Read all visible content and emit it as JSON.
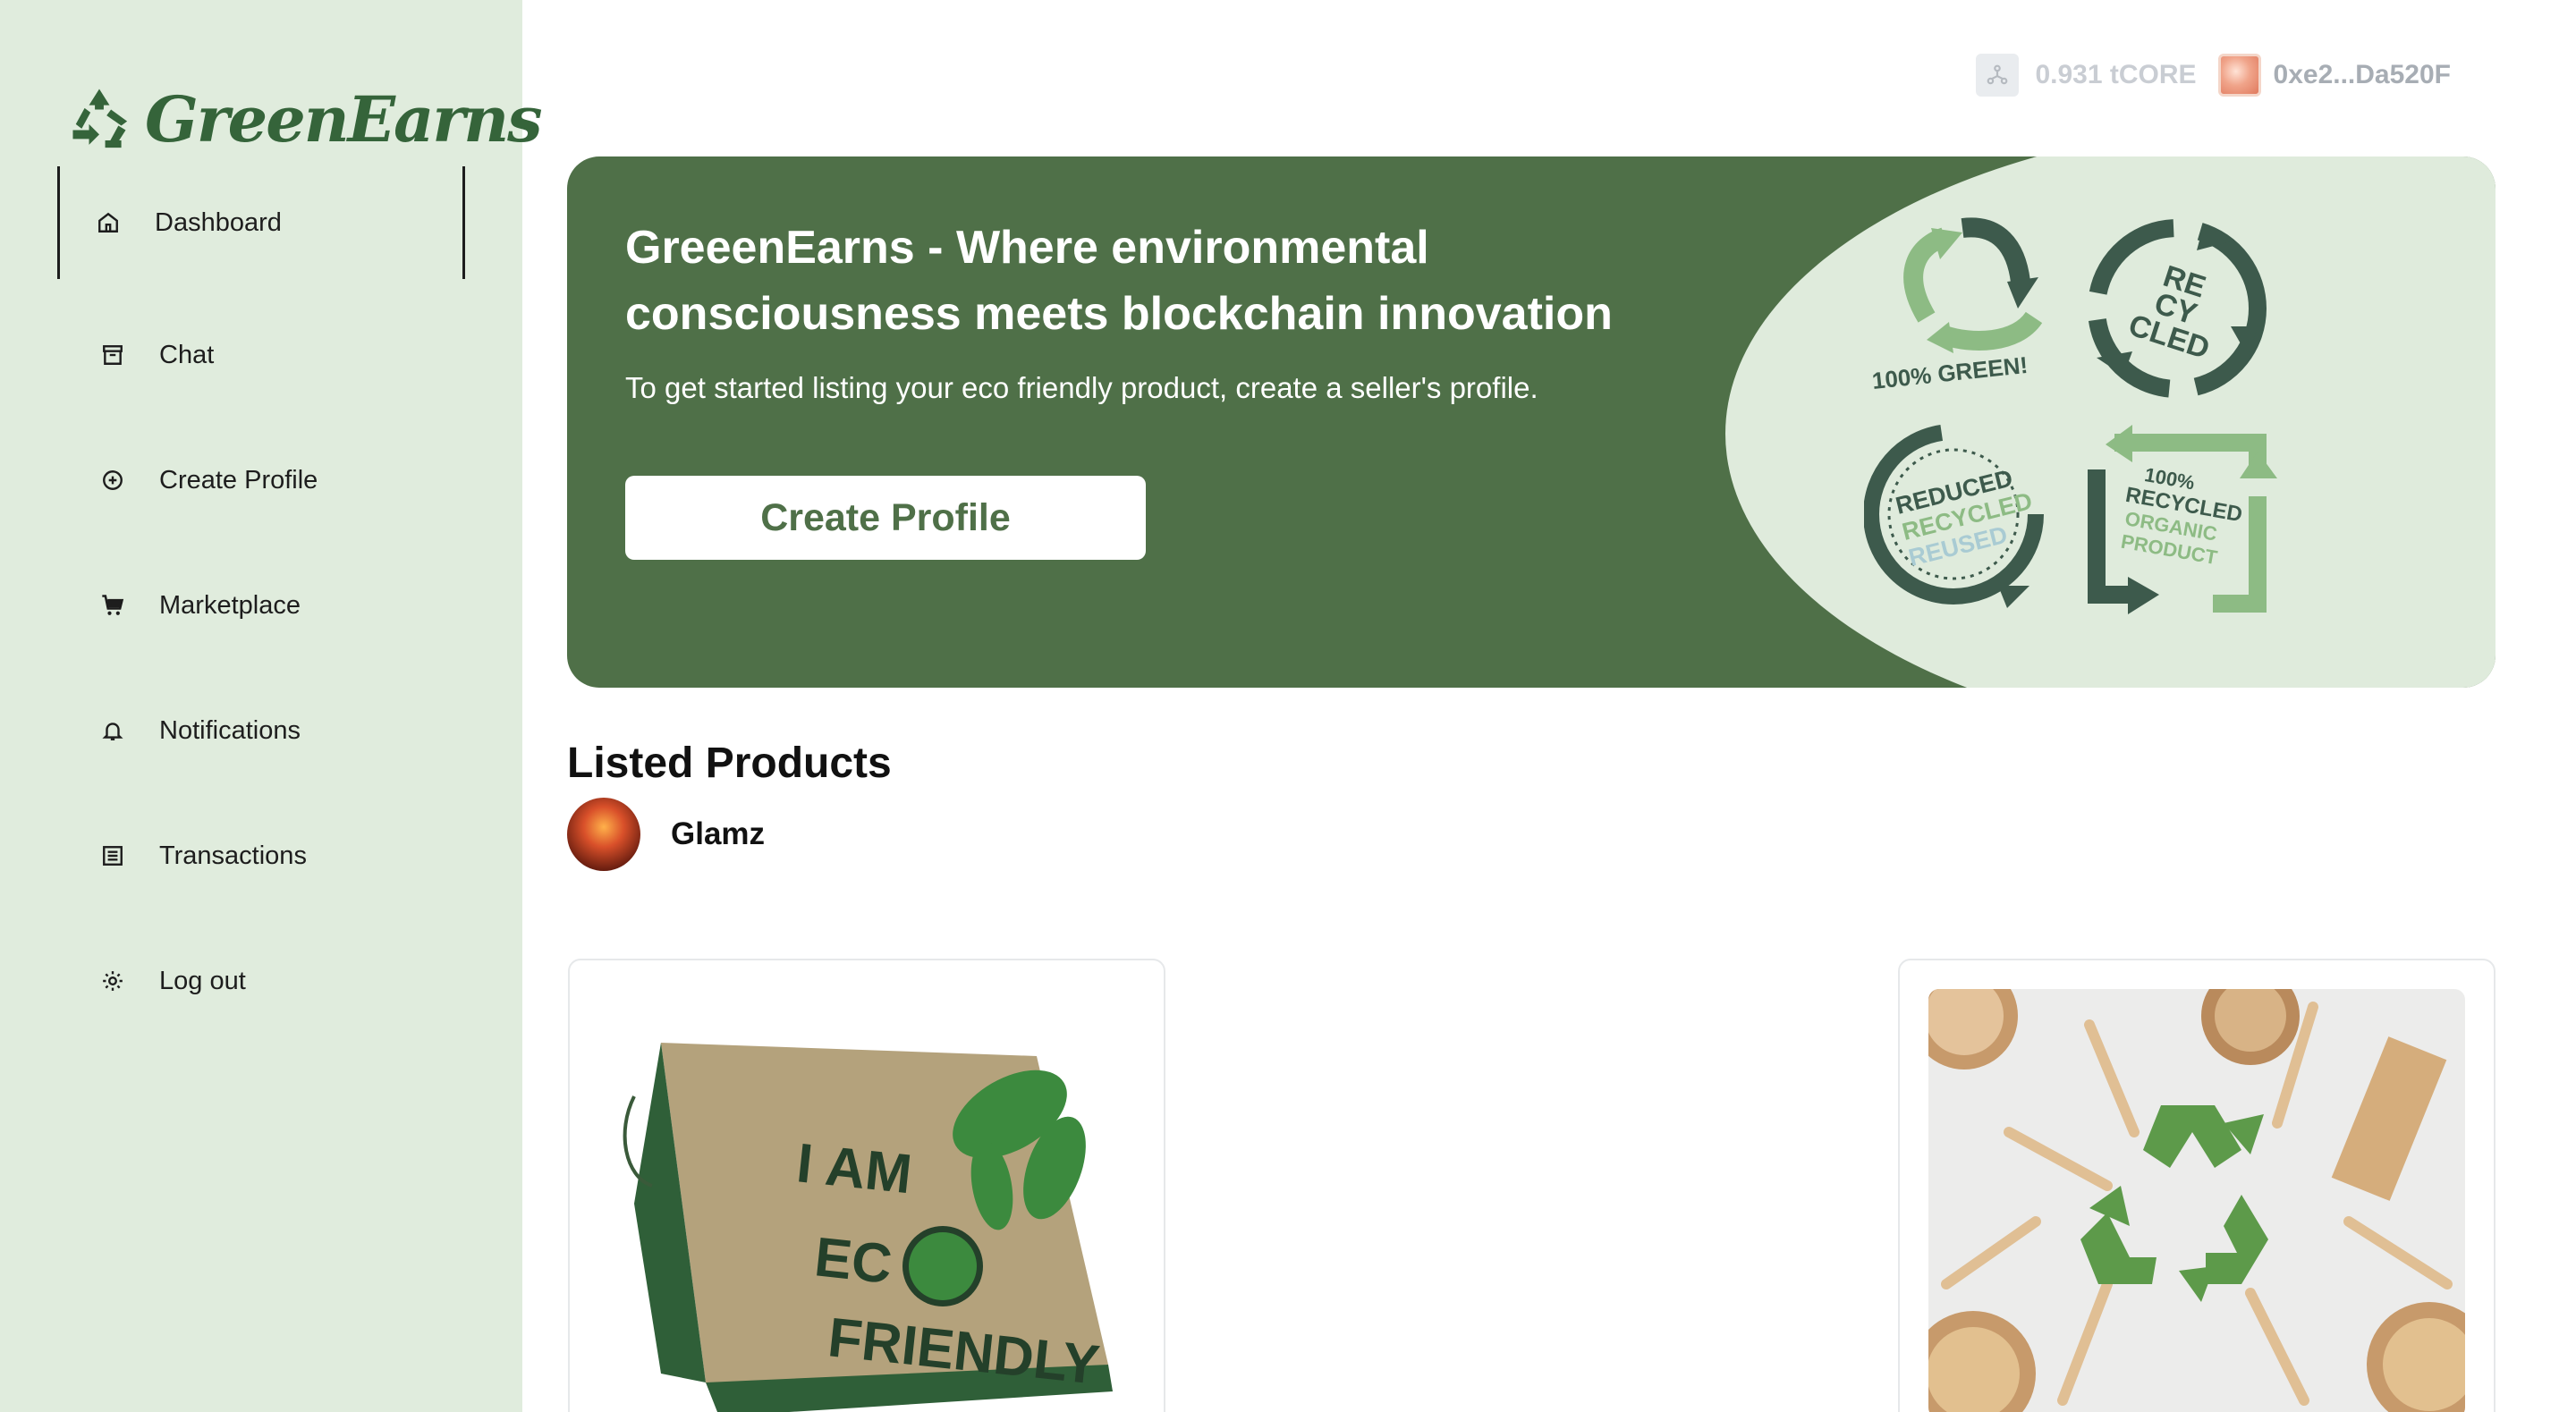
{
  "brand": {
    "name": "GreenEarns",
    "color": "#35643a"
  },
  "nav": {
    "items": [
      {
        "label": "Dashboard",
        "icon": "home-icon",
        "active": true
      },
      {
        "label": "Chat",
        "icon": "archive-icon"
      },
      {
        "label": "Create Profile",
        "icon": "plus-circle-icon"
      },
      {
        "label": "Marketplace",
        "icon": "cart-icon"
      },
      {
        "label": "Notifications",
        "icon": "bell-icon"
      },
      {
        "label": "Transactions",
        "icon": "receipt-icon"
      },
      {
        "label": "Log out",
        "icon": "gear-icon"
      }
    ]
  },
  "wallet": {
    "balance": "0.931 tCORE",
    "address": "0xe2...Da520F"
  },
  "hero": {
    "title": "GreeenEarns - Where environmental consciousness meets blockchain innovation",
    "subtitle": "To get started listing your eco friendly product, create a seller's profile.",
    "button_label": "Create Profile",
    "badges": {
      "b1": "100% GREEN!",
      "b2_l1": "RE",
      "b2_l2": "CY",
      "b2_l3": "CLED",
      "b3_l1": "REDUCED",
      "b3_l2": "RECYCLED",
      "b3_l3": "REUSED",
      "b4_l1": "100%",
      "b4_l2": "RECYCLED",
      "b4_l3": "ORGANIC",
      "b4_l4": "PRODUCT"
    },
    "colors": {
      "banner": "#4f7048",
      "oval": "#dfebdc"
    }
  },
  "products": {
    "section_title": "Listed Products",
    "seller_name": "Glamz",
    "items": [
      {
        "image_text_1": "I AM",
        "image_text_2": "EC",
        "image_text_3": "FRIENDLY"
      },
      {
        "image": "recycle-symbol-with-utensils"
      }
    ]
  }
}
